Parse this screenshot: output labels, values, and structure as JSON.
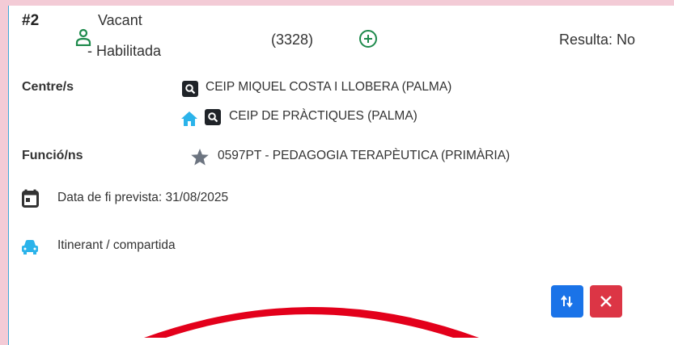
{
  "header": {
    "number": "#2",
    "status_line1": "Vacant",
    "status_line2": "- Habilitada",
    "code": "(3328)",
    "result": "Resulta: No"
  },
  "centres": {
    "label": "Centre/s",
    "items": [
      "CEIP MIQUEL COSTA I LLOBERA (PALMA)",
      "CEIP DE PRÀCTIQUES (PALMA)"
    ]
  },
  "funcions": {
    "label": "Funció/ns",
    "value": "0597PT - PEDAGOGIA TERAPÈUTICA (PRIMÀRIA)"
  },
  "end_date": "Data de fi prevista: 31/08/2025",
  "itinerant": "Itinerant / compartida",
  "colors": {
    "accent_green": "#1e8a4c",
    "home_blue": "#2bb3ea",
    "swap_button": "#1a73e8",
    "delete_button": "#dc3545",
    "header_pink": "#f3cbd6",
    "ribbon_red": "#e3001b"
  },
  "icons": [
    "person-icon",
    "add-circle-icon",
    "search-icon",
    "home-icon",
    "star-icon",
    "calendar-icon",
    "car-icon",
    "swap-icon",
    "close-icon"
  ]
}
